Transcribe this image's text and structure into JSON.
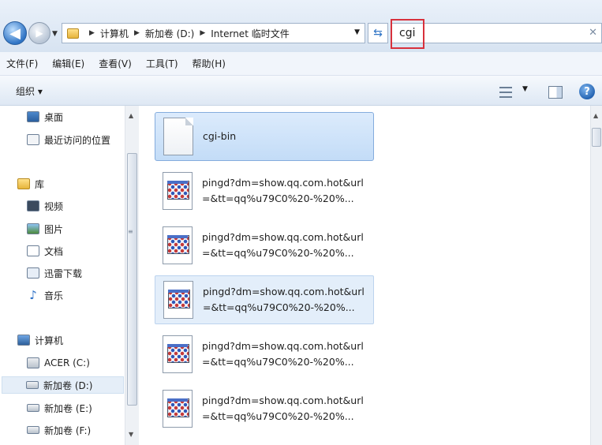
{
  "address": {
    "crumbs": [
      "计算机",
      "新加卷 (D:)",
      "Internet 临时文件"
    ]
  },
  "search": {
    "value": "cgi"
  },
  "menu": [
    "文件(F)",
    "编辑(E)",
    "查看(V)",
    "工具(T)",
    "帮助(H)"
  ],
  "toolbar": {
    "organize": "组织 ▾"
  },
  "nav": {
    "favorites": [
      {
        "label": "桌面",
        "icon": "desktop-icon"
      },
      {
        "label": "最近访问的位置",
        "icon": "recent-places-icon"
      }
    ],
    "library": {
      "label": "库",
      "items": [
        {
          "label": "视频",
          "icon": "video-library-icon"
        },
        {
          "label": "图片",
          "icon": "picture-library-icon"
        },
        {
          "label": "文档",
          "icon": "document-library-icon"
        },
        {
          "label": "迅雷下载",
          "icon": "thunder-download-icon"
        },
        {
          "label": "音乐",
          "icon": "music-library-icon"
        }
      ]
    },
    "computer": {
      "label": "计算机",
      "drives": [
        {
          "label": "ACER (C:)",
          "icon": "system-drive-icon"
        },
        {
          "label": "新加卷 (D:)",
          "icon": "drive-icon",
          "selected": true
        },
        {
          "label": "新加卷 (E:)",
          "icon": "drive-icon"
        },
        {
          "label": "新加卷 (F:)",
          "icon": "drive-icon"
        }
      ]
    }
  },
  "files": [
    {
      "name": "cgi-bin",
      "type": "folder",
      "state": "selected"
    },
    {
      "name": "pingd?dm=show.qq.com.hot&url=&tt=qq%u79C0%20-%20%...",
      "type": "app"
    },
    {
      "name": "pingd?dm=show.qq.com.hot&url=&tt=qq%u79C0%20-%20%...",
      "type": "app"
    },
    {
      "name": "pingd?dm=show.qq.com.hot&url=&tt=qq%u79C0%20-%20%...",
      "type": "app",
      "state": "highlight"
    },
    {
      "name": "pingd?dm=show.qq.com.hot&url=&tt=qq%u79C0%20-%20%...",
      "type": "app"
    },
    {
      "name": "pingd?dm=show.qq.com.hot&url=&tt=qq%u79C0%20-%20%...",
      "type": "app"
    }
  ]
}
